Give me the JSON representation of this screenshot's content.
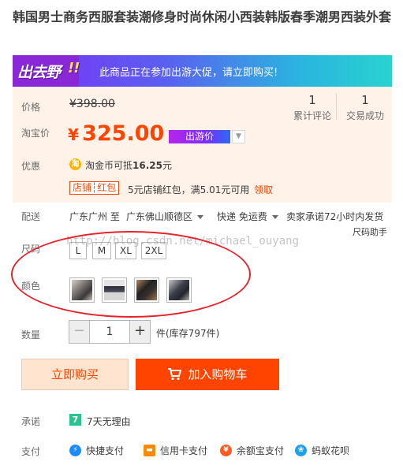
{
  "title": "韩国男士商务西服套装潮修身时尚休闲小西装韩版春季潮男西装外套",
  "promo": {
    "logo_text": "出去野",
    "logo_bang": "!!",
    "text": "此商品正在参加出游大促，请立即购买!",
    "colors": [
      "#7b2ff7",
      "#28d3cf"
    ]
  },
  "price": {
    "orig_label": "价格",
    "orig_value": "¥398.00",
    "current_label": "淘宝价",
    "current_yen": "¥",
    "current_value": "325.00",
    "tour_tag": "出游价",
    "accent": "#ff4400"
  },
  "stats": [
    {
      "count": "1",
      "label": "累计评论"
    },
    {
      "count": "1",
      "label": "交易成功"
    }
  ],
  "coupon": {
    "label": "优惠",
    "taojin_icon": "淘",
    "taojin_text_prefix": "淘金币可抵",
    "taojin_amount": "16.25",
    "taojin_suffix": "元",
    "shop_tag": "店铺┆红包",
    "shop_text": "5元店铺红包，满5.01元可用",
    "claim": "领取"
  },
  "shipping": {
    "label": "配送",
    "from": "广东广州 至",
    "to": "广东佛山顺德区",
    "method": "快递 免运费",
    "promise": "卖家承诺72小时内发货",
    "helper": "尺码助手"
  },
  "size": {
    "label": "尺码",
    "options": [
      "L",
      "M",
      "XL",
      "2XL"
    ]
  },
  "color": {
    "label": "颜色",
    "swatches": [
      "suit-grey-icon",
      "suit-navy-icon",
      "suit-black-icon",
      "suit-darkgrey-icon"
    ]
  },
  "watermark": "http://blog.csdn.net/michael_ouyang",
  "quantity": {
    "label": "数量",
    "minus": "−",
    "value": "1",
    "plus": "+",
    "stock": "件(库存797件)"
  },
  "actions": {
    "buy": "立即购买",
    "cart": "加入购物车"
  },
  "promise": {
    "label": "承诺",
    "icon": "7",
    "text": "7天无理由"
  },
  "payment": {
    "label": "支付",
    "methods": [
      {
        "icon": "quickpay-icon",
        "label": "快捷支付",
        "color": "#1a8cff"
      },
      {
        "icon": "creditcard-icon",
        "label": "信用卡支付",
        "color": "#ff8a00"
      },
      {
        "icon": "yuebao-icon",
        "label": "余额宝支付",
        "color": "#ff5a1f"
      },
      {
        "icon": "huabei-icon",
        "label": "蚂蚁花呗",
        "color": "#1fa0e8"
      }
    ]
  }
}
